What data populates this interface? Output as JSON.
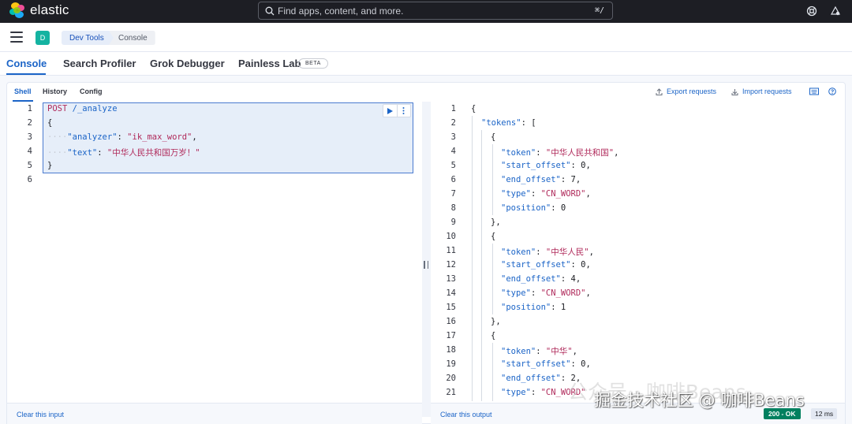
{
  "app": {
    "name": "elastic"
  },
  "search": {
    "placeholder": "Find apps, content, and more.",
    "shortcut": "⌘/"
  },
  "breadcrumb": {
    "space": "D",
    "items": [
      "Dev Tools",
      "Console"
    ]
  },
  "tabs": [
    {
      "label": "Console",
      "active": true
    },
    {
      "label": "Search Profiler"
    },
    {
      "label": "Grok Debugger"
    },
    {
      "label": "Painless Lab",
      "badge": "BETA"
    }
  ],
  "subtabs": [
    {
      "label": "Shell",
      "active": true
    },
    {
      "label": "History"
    },
    {
      "label": "Config"
    }
  ],
  "actions": {
    "export": "Export requests",
    "import": "Import requests"
  },
  "request": {
    "line_numbers": [
      "1",
      "2",
      "3",
      "4",
      "5",
      "6"
    ],
    "method": "POST",
    "path": "/_analyze",
    "analyzer_key": "\"analyzer\"",
    "analyzer_val": "\"ik_max_word\"",
    "text_key": "\"text\"",
    "text_val": "\"中华人民共和国万岁！\""
  },
  "response": {
    "line_numbers": [
      "1",
      "2",
      "3",
      "4",
      "5",
      "6",
      "7",
      "8",
      "9",
      "10",
      "11",
      "12",
      "13",
      "14",
      "15",
      "16",
      "17",
      "18",
      "19",
      "20",
      "21"
    ],
    "tokens_key": "\"tokens\"",
    "items": [
      {
        "token": "\"中华人民共和国\"",
        "start_offset": "0",
        "end_offset": "7",
        "type": "\"CN_WORD\"",
        "position": "0"
      },
      {
        "token": "\"中华人民\"",
        "start_offset": "0",
        "end_offset": "4",
        "type": "\"CN_WORD\"",
        "position": "1"
      },
      {
        "token": "\"中华\"",
        "start_offset": "0",
        "end_offset": "2",
        "type": "\"CN_WORD\""
      }
    ]
  },
  "footer": {
    "clear_input": "Clear this input",
    "clear_output": "Clear this output",
    "status": "200 - OK",
    "time": "12 ms"
  },
  "watermark": {
    "line1": "公众号 · 咖啡Beans",
    "line2": "掘金技术社区 @ 咖啡Beans"
  },
  "colors": {
    "accent": "#1b64c7",
    "topbar": "#1d1e24",
    "success": "#00805f"
  }
}
